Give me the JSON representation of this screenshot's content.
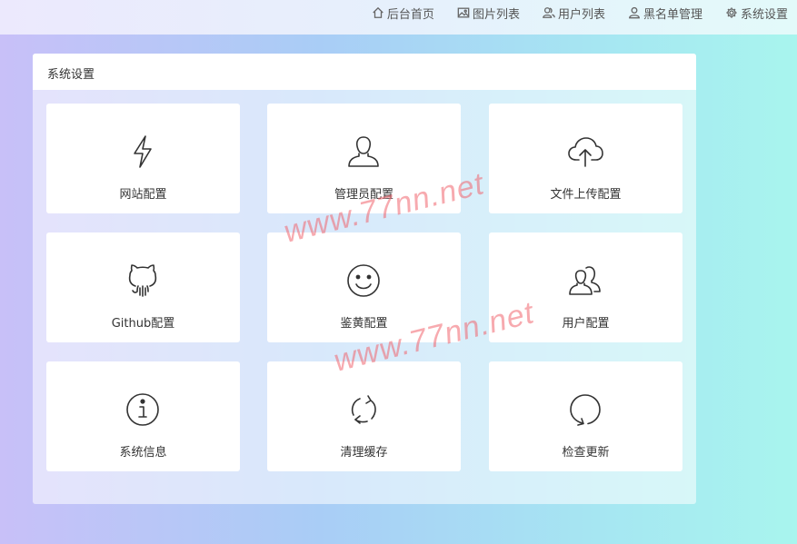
{
  "nav": {
    "items": [
      {
        "label": "后台首页",
        "icon": "home-icon"
      },
      {
        "label": "图片列表",
        "icon": "image-icon"
      },
      {
        "label": "用户列表",
        "icon": "users-icon"
      },
      {
        "label": "黑名单管理",
        "icon": "user-icon"
      },
      {
        "label": "系统设置",
        "icon": "gear-icon"
      }
    ]
  },
  "panel": {
    "title": "系统设置",
    "cards": [
      {
        "label": "网站配置",
        "icon": "lightning-icon"
      },
      {
        "label": "管理员配置",
        "icon": "user-icon"
      },
      {
        "label": "文件上传配置",
        "icon": "cloud-upload-icon"
      },
      {
        "label": "Github配置",
        "icon": "github-icon"
      },
      {
        "label": "鉴黄配置",
        "icon": "smile-icon"
      },
      {
        "label": "用户配置",
        "icon": "users-icon"
      },
      {
        "label": "系统信息",
        "icon": "info-icon"
      },
      {
        "label": "清理缓存",
        "icon": "refresh-icon"
      },
      {
        "label": "检查更新",
        "icon": "update-icon"
      }
    ]
  },
  "watermark": {
    "text": "www.77nn.net"
  }
}
